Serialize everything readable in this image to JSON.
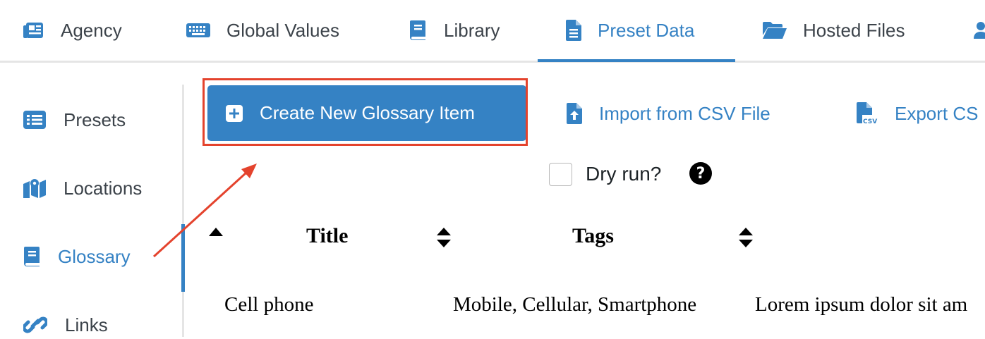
{
  "top_tabs": [
    {
      "label": "Agency",
      "icon": "newspaper-icon"
    },
    {
      "label": "Global Values",
      "icon": "keyboard-icon"
    },
    {
      "label": "Library",
      "icon": "book-icon"
    },
    {
      "label": "Preset Data",
      "icon": "file-icon",
      "active": true
    },
    {
      "label": "Hosted Files",
      "icon": "folder-open-icon"
    },
    {
      "label": "",
      "icon": "users-icon"
    }
  ],
  "sidebar": {
    "items": [
      {
        "label": "Presets",
        "icon": "list-icon"
      },
      {
        "label": "Locations",
        "icon": "map-icon"
      },
      {
        "label": "Glossary",
        "icon": "book-icon",
        "active": true
      },
      {
        "label": "Links",
        "icon": "link-icon"
      }
    ]
  },
  "actions": {
    "create_label": "Create New Glossary Item",
    "import_label": "Import from CSV File",
    "export_label": "Export CS"
  },
  "dry_run": {
    "label": "Dry run?",
    "checked": false,
    "help": "?"
  },
  "table": {
    "columns": [
      "Title",
      "Tags"
    ],
    "rows": [
      {
        "title": "Cell phone",
        "tags": "Mobile, Cellular, Smartphone",
        "description": "Lorem ipsum dolor sit am"
      }
    ]
  },
  "colors": {
    "accent": "#3582c4",
    "highlight": "#e4432d",
    "text": "#3c434a"
  }
}
